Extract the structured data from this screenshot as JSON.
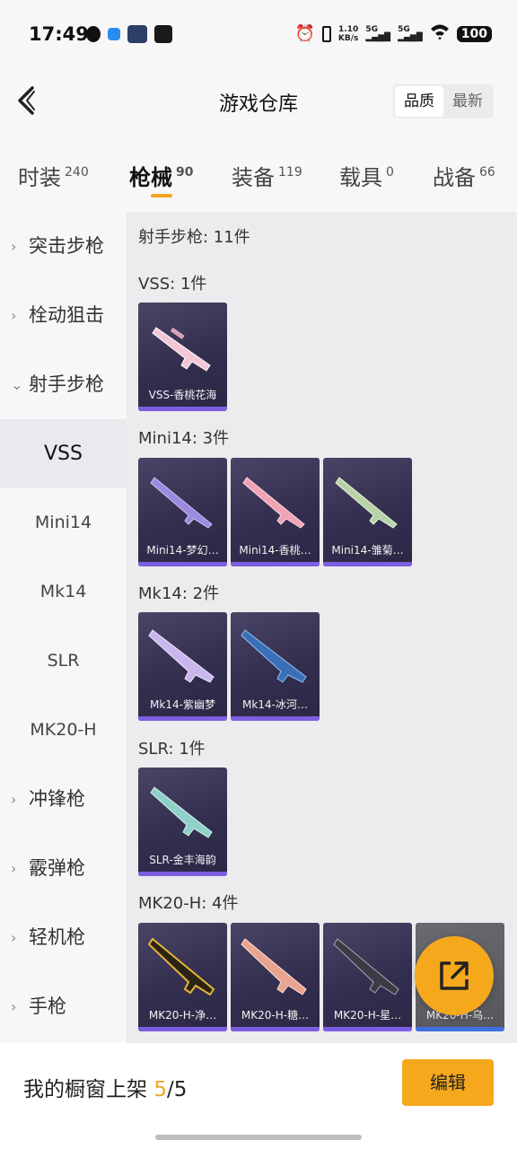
{
  "status_bar": {
    "time": "17:49",
    "net_speed": "1.10",
    "net_unit": "KB/s",
    "signal1": "5G",
    "signal2": "5G",
    "battery": "100"
  },
  "header": {
    "title": "游戏仓库",
    "sort_options": [
      "品质",
      "最新"
    ]
  },
  "tabs": [
    {
      "label": "时装",
      "count": "240"
    },
    {
      "label": "枪械",
      "count": "90"
    },
    {
      "label": "装备",
      "count": "119"
    },
    {
      "label": "载具",
      "count": "0"
    },
    {
      "label": "战备",
      "count": "66"
    }
  ],
  "sidebar": {
    "items": [
      {
        "label": "突击步枪",
        "chevron": "›"
      },
      {
        "label": "栓动狙击",
        "chevron": "›"
      },
      {
        "label": "射手步枪",
        "chevron": "⌄"
      },
      {
        "label": "VSS"
      },
      {
        "label": "Mini14"
      },
      {
        "label": "Mk14"
      },
      {
        "label": "SLR"
      },
      {
        "label": "MK20-H"
      },
      {
        "label": "冲锋枪",
        "chevron": "›"
      },
      {
        "label": "霰弹枪",
        "chevron": "›"
      },
      {
        "label": "轻机枪",
        "chevron": "›"
      },
      {
        "label": "手枪",
        "chevron": "›"
      }
    ]
  },
  "content": {
    "summary": "射手步枪: 11件",
    "groups": [
      {
        "title": "VSS: 1件",
        "items": [
          "VSS-香桃花海"
        ]
      },
      {
        "title": "Mini14: 3件",
        "items": [
          "Mini14-梦幻…",
          "Mini14-香桃…",
          "Mini14-雏菊…"
        ]
      },
      {
        "title": "Mk14: 2件",
        "items": [
          "Mk14-紫幽梦",
          "Mk14-冰河…"
        ]
      },
      {
        "title": "SLR: 1件",
        "items": [
          "SLR-金丰海韵"
        ]
      },
      {
        "title": "MK20-H: 4件",
        "items": [
          "MK20-H-净…",
          "MK20-H-糖…",
          "MK20-H-星…",
          "MK20-H-乌…"
        ]
      }
    ]
  },
  "bottom_bar": {
    "showcase_label": "我的橱窗上架",
    "showcase_count": "5",
    "showcase_total": "/5",
    "edit_label": "编辑"
  },
  "icons": {
    "back": "back-arrow-icon",
    "fab": "share-external-icon"
  },
  "colors": {
    "accent": "#f6a81d",
    "card_rarity": "#7b5fe0"
  }
}
